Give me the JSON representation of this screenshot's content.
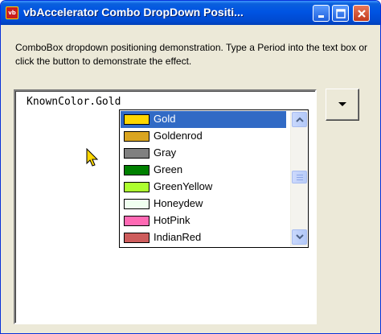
{
  "window": {
    "title": "vbAccelerator Combo DropDown Positi...",
    "app_icon_text": "vb"
  },
  "description": "ComboBox dropdown positioning demonstration. Type a Period into the text box or click the button to demonstrate the effect.",
  "textbox": {
    "value": "KnownColor.Gold"
  },
  "dropdown": {
    "selected_index": 0,
    "items": [
      {
        "label": "Gold",
        "color": "#FFD700"
      },
      {
        "label": "Goldenrod",
        "color": "#DAA520"
      },
      {
        "label": "Gray",
        "color": "#808080"
      },
      {
        "label": "Green",
        "color": "#008000"
      },
      {
        "label": "GreenYellow",
        "color": "#ADFF2F"
      },
      {
        "label": "Honeydew",
        "color": "#F0FFF0"
      },
      {
        "label": "HotPink",
        "color": "#FF69B4"
      },
      {
        "label": "IndianRed",
        "color": "#CD5C5C"
      }
    ]
  },
  "colors": {
    "selection": "#316AC5",
    "titlebar": "#0054E3"
  }
}
